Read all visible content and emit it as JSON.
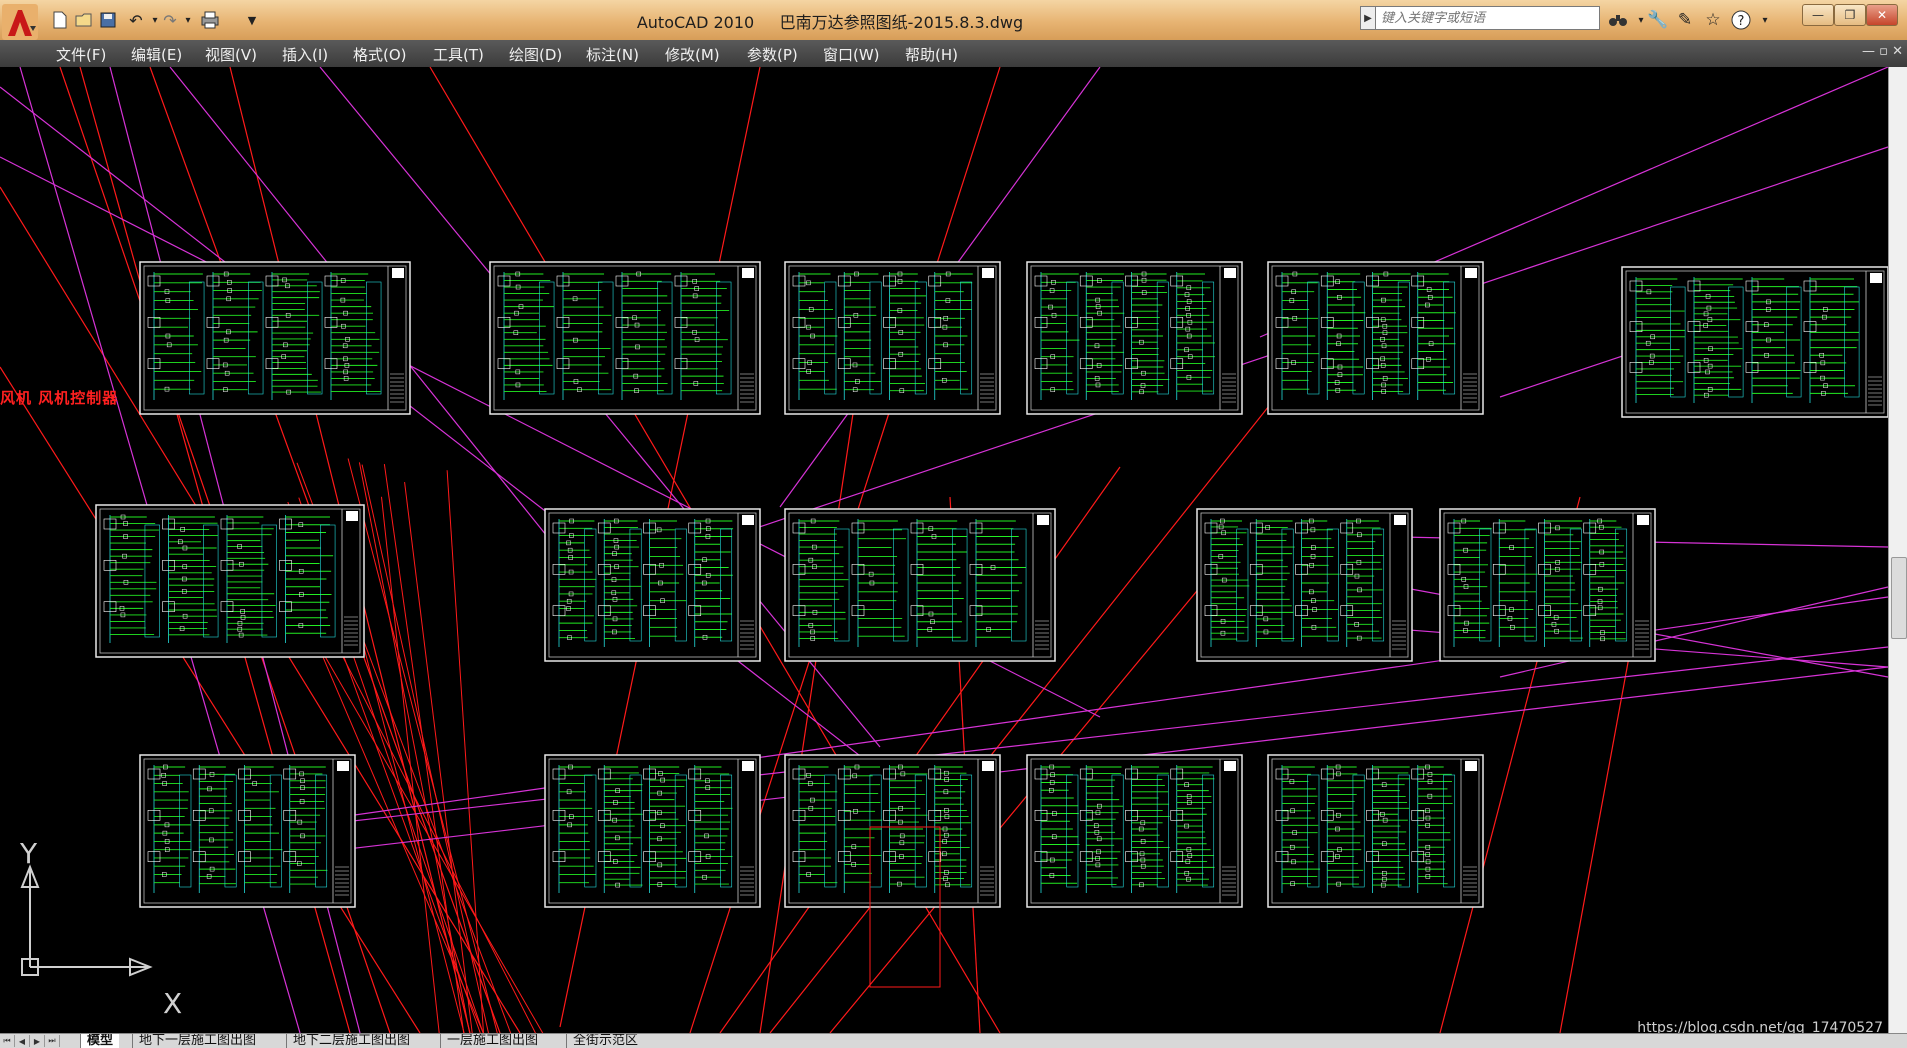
{
  "window": {
    "app_name": "AutoCAD 2010",
    "document": "巴南万达参照图纸-2015.8.3.dwg"
  },
  "quick_access": [
    {
      "icon": "new-file-icon"
    },
    {
      "icon": "open-folder-icon"
    },
    {
      "icon": "save-icon"
    },
    {
      "icon": "undo-icon"
    },
    {
      "icon": "redo-icon"
    },
    {
      "icon": "plot-icon"
    }
  ],
  "search": {
    "placeholder": "键入关键字或短语"
  },
  "menu": [
    "文件(F)",
    "编辑(E)",
    "视图(V)",
    "插入(I)",
    "格式(O)",
    "工具(T)",
    "绘图(D)",
    "标注(N)",
    "修改(M)",
    "参数(P)",
    "窗口(W)",
    "帮助(H)"
  ],
  "canvas": {
    "side_label": "风机 风机控制器",
    "ucs_x": "X",
    "ucs_y": "Y"
  },
  "layout_tabs": [
    "模型",
    "地下一层施工图出图",
    "地下二层施工图出图",
    "一层施工图出图",
    "全街示范区"
  ],
  "watermark": "https://blog.csdn.net/qq_17470527",
  "colors": {
    "background": "#000000",
    "wire_red": "#ff1a1a",
    "wire_magenta": "#d633d6",
    "drawing_green": "#22ee22",
    "drawing_cyan": "#22dddd"
  }
}
